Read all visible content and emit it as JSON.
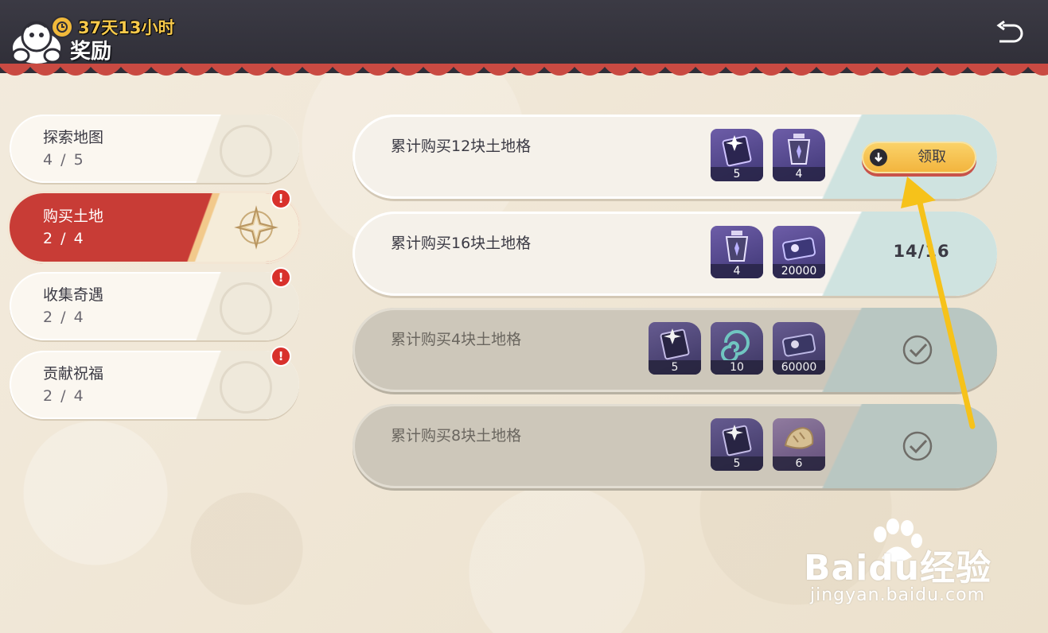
{
  "header": {
    "timer_text": "37天13小时",
    "title": "奖励"
  },
  "tabs": [
    {
      "label": "探索地图",
      "count": "4 / 5",
      "active": false,
      "alert": false
    },
    {
      "label": "购买土地",
      "count": "2 / 4",
      "active": true,
      "alert": true
    },
    {
      "label": "收集奇遇",
      "count": "2 / 4",
      "active": false,
      "alert": true
    },
    {
      "label": "贡献祝福",
      "count": "2 / 4",
      "active": false,
      "alert": true
    }
  ],
  "alert_glyph": "!",
  "rewards": [
    {
      "title": "累计购买12块土地格",
      "items": [
        {
          "icon": "ticket-card-icon",
          "qty": "5"
        },
        {
          "icon": "lantern-icon",
          "qty": "4"
        }
      ],
      "state": "claimable",
      "claim_label": "领取"
    },
    {
      "title": "累计购买16块土地格",
      "items": [
        {
          "icon": "lantern-icon",
          "qty": "4"
        },
        {
          "icon": "coin-card-icon",
          "qty": "20000"
        }
      ],
      "state": "in-progress",
      "progress_text": "14/16"
    },
    {
      "title": "累计购买4块土地格",
      "items": [
        {
          "icon": "ticket-card-icon",
          "qty": "5"
        },
        {
          "icon": "swirl-icon",
          "qty": "10"
        },
        {
          "icon": "coin-card-icon",
          "qty": "60000"
        }
      ],
      "state": "claimed"
    },
    {
      "title": "累计购买8块土地格",
      "items": [
        {
          "icon": "ticket-card-icon",
          "qty": "5"
        },
        {
          "icon": "bread-icon",
          "qty": "6"
        }
      ],
      "state": "claimed"
    }
  ],
  "watermark": {
    "brand": "Baidu经验",
    "url": "jingyan.baidu.com"
  },
  "colors": {
    "header_bg": "#2f2e37",
    "active_tab": "#c83c36",
    "claim_button": "#f2b33c",
    "alert": "#d8312c",
    "annotation_arrow": "#f6c21a"
  }
}
